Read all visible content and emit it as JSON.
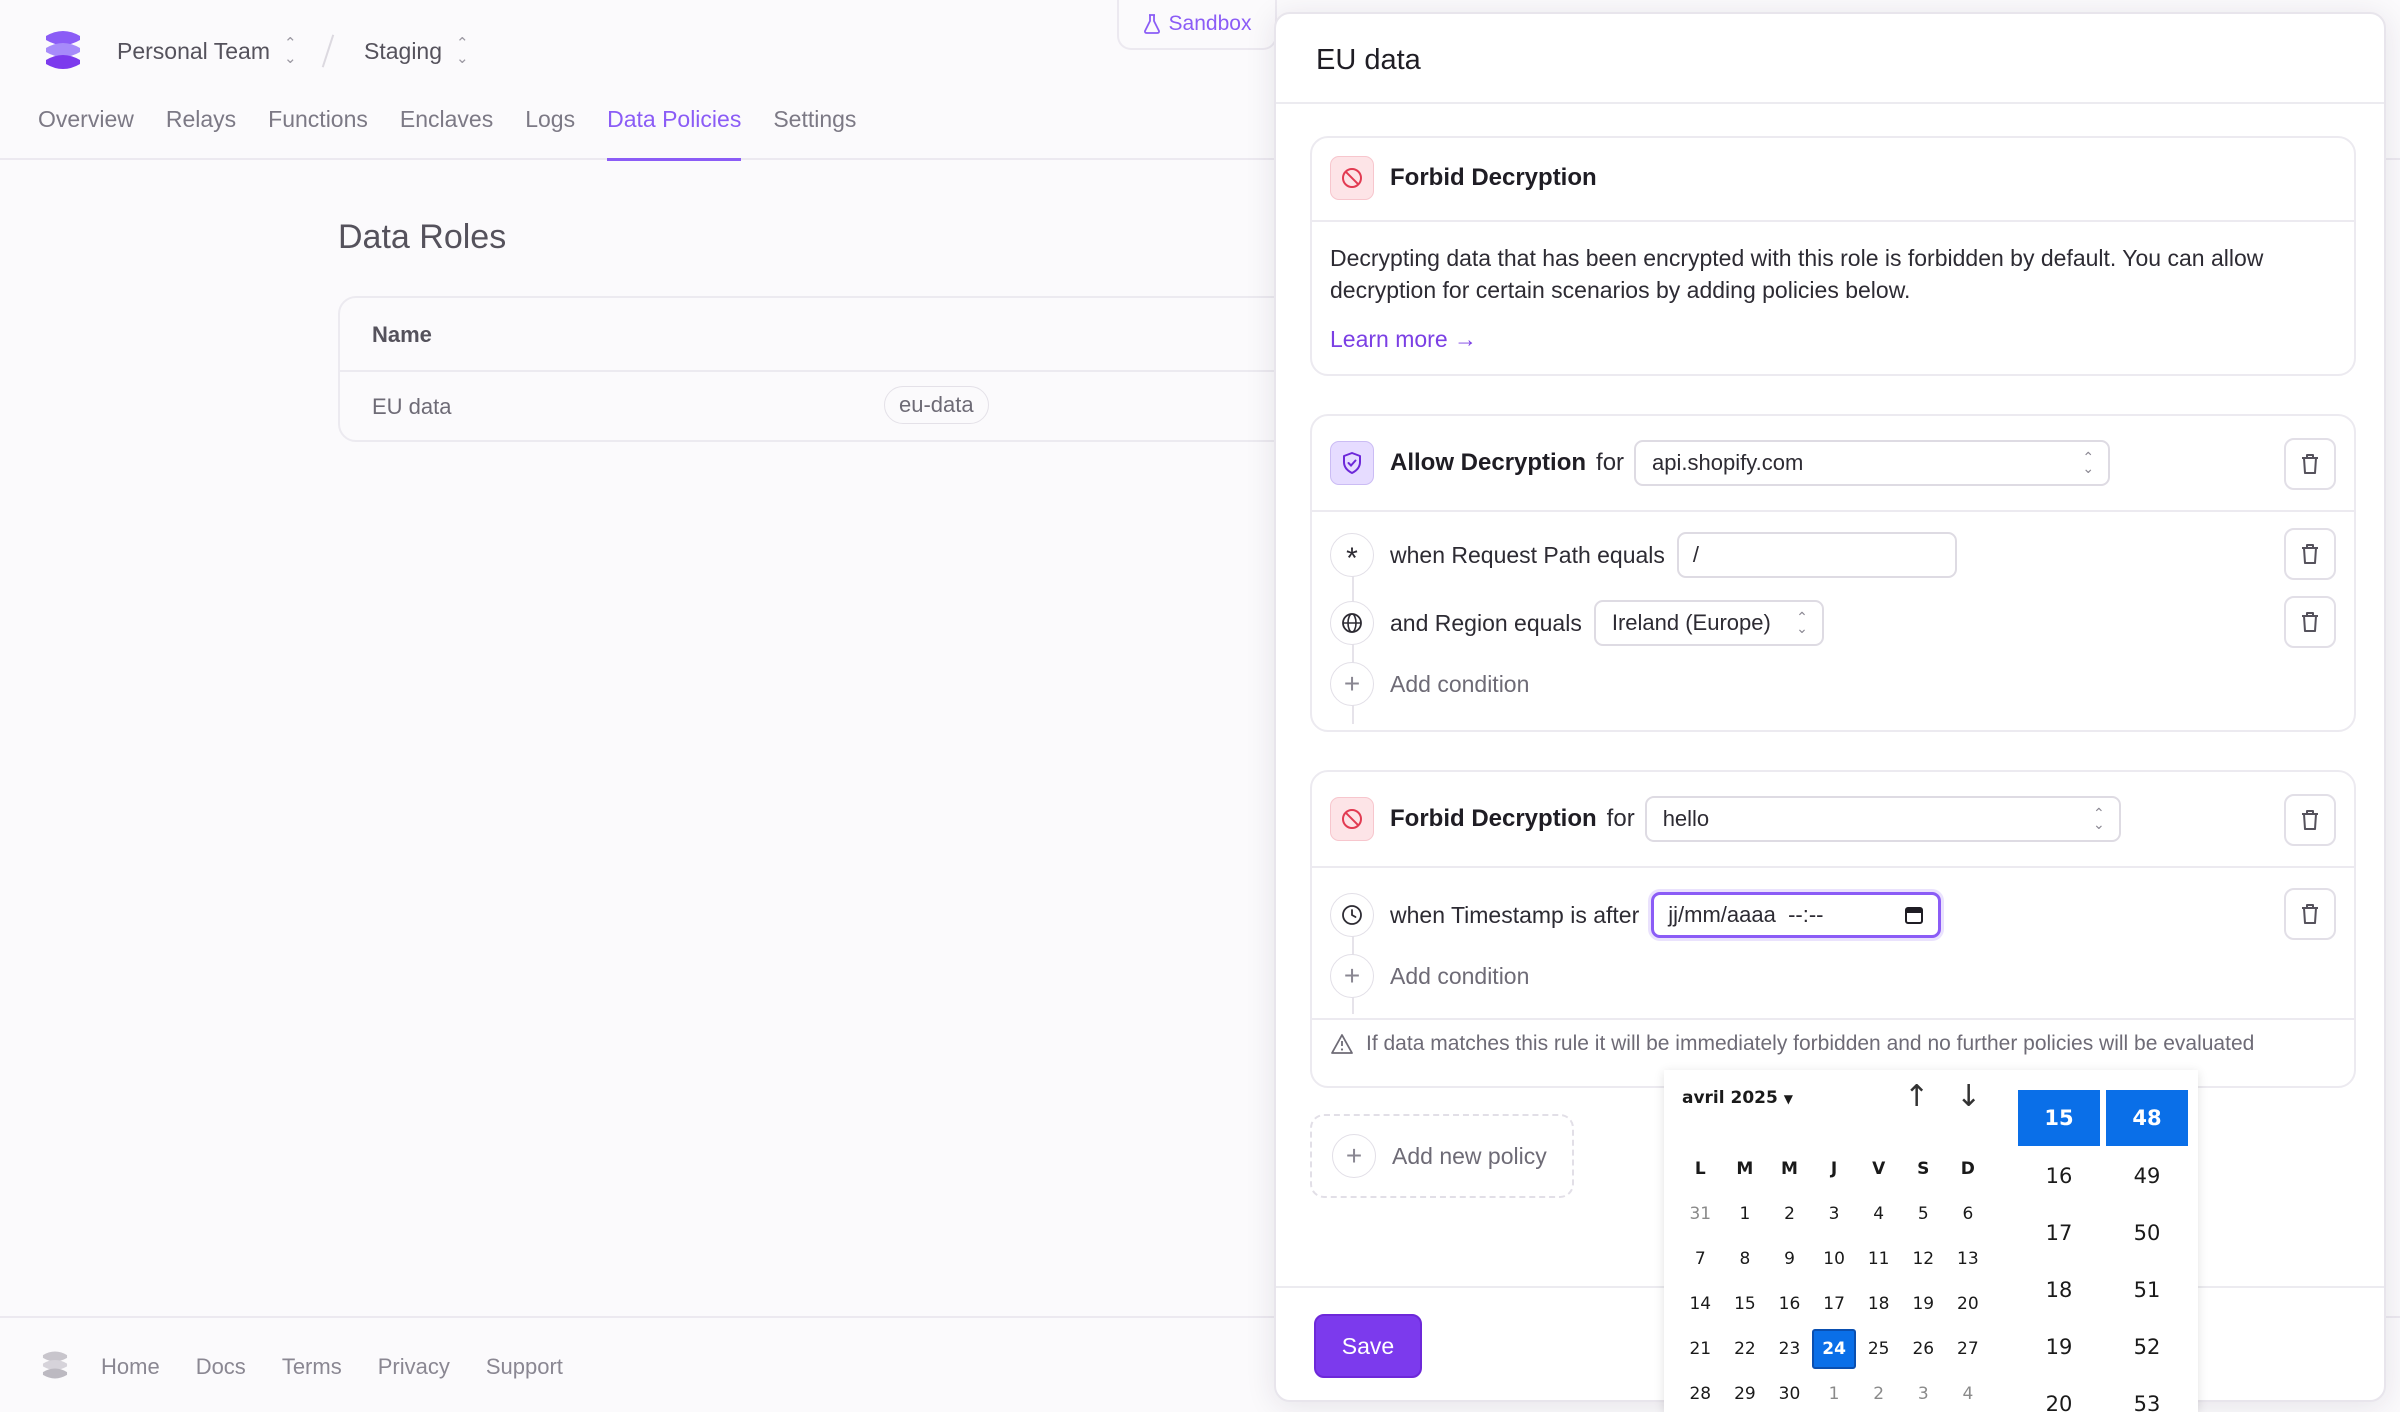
{
  "header": {
    "team": "Personal Team",
    "environment": "Staging",
    "sandbox_label": "Sandbox",
    "tabs": [
      {
        "label": "Overview"
      },
      {
        "label": "Relays"
      },
      {
        "label": "Functions"
      },
      {
        "label": "Enclaves"
      },
      {
        "label": "Logs"
      },
      {
        "label": "Data Policies",
        "active": true
      },
      {
        "label": "Settings"
      }
    ]
  },
  "roles": {
    "title": "Data Roles",
    "column_name": "Name",
    "rows": [
      {
        "name": "EU data",
        "key": "eu-data"
      }
    ]
  },
  "footer": {
    "links": [
      "Home",
      "Docs",
      "Terms",
      "Privacy",
      "Support"
    ]
  },
  "drawer": {
    "title": "EU data",
    "default_policy": {
      "label": "Forbid Decryption",
      "description": "Decrypting data that has been encrypted with this role is forbidden by default. You can allow decryption for certain scenarios by adding policies below.",
      "learn_more": "Learn more →"
    },
    "policies": [
      {
        "type_label": "Allow Decryption",
        "for_label": "for",
        "target": "api.shopify.com",
        "conditions": [
          {
            "text": "when Request Path equals",
            "value": "/",
            "icon": "asterisk-icon"
          },
          {
            "text": "and Region equals",
            "value": "Ireland (Europe)",
            "icon": "globe-icon"
          }
        ],
        "add_condition": "Add condition"
      },
      {
        "type_label": "Forbid Decryption",
        "for_label": "for",
        "target": "hello",
        "conditions": [
          {
            "text": "when Timestamp is after",
            "value": "jj/mm/aaaa  --:--",
            "icon": "clock-icon"
          }
        ],
        "add_condition": "Add condition",
        "warning": "If data matches this rule it will be immediately forbidden and no further policies will be evaluated"
      }
    ],
    "add_policy": "Add new policy",
    "save_label": "Save"
  },
  "picker": {
    "month_label": "avril 2025",
    "weekdays": [
      "L",
      "M",
      "M",
      "J",
      "V",
      "S",
      "D"
    ],
    "weeks": [
      [
        {
          "d": "31",
          "dim": true
        },
        {
          "d": "1"
        },
        {
          "d": "2"
        },
        {
          "d": "3"
        },
        {
          "d": "4"
        },
        {
          "d": "5"
        },
        {
          "d": "6"
        }
      ],
      [
        {
          "d": "7"
        },
        {
          "d": "8"
        },
        {
          "d": "9"
        },
        {
          "d": "10"
        },
        {
          "d": "11"
        },
        {
          "d": "12"
        },
        {
          "d": "13"
        }
      ],
      [
        {
          "d": "14"
        },
        {
          "d": "15"
        },
        {
          "d": "16"
        },
        {
          "d": "17"
        },
        {
          "d": "18"
        },
        {
          "d": "19"
        },
        {
          "d": "20"
        }
      ],
      [
        {
          "d": "21"
        },
        {
          "d": "22"
        },
        {
          "d": "23"
        },
        {
          "d": "24",
          "sel": true
        },
        {
          "d": "25"
        },
        {
          "d": "26"
        },
        {
          "d": "27"
        }
      ],
      [
        {
          "d": "28"
        },
        {
          "d": "29"
        },
        {
          "d": "30"
        },
        {
          "d": "1",
          "dim": true
        },
        {
          "d": "2",
          "dim": true
        },
        {
          "d": "3",
          "dim": true
        },
        {
          "d": "4",
          "dim": true
        }
      ]
    ],
    "hours": [
      "15",
      "16",
      "17",
      "18",
      "19",
      "20"
    ],
    "selected_hour": "15",
    "minutes": [
      "48",
      "49",
      "50",
      "51",
      "52",
      "53"
    ],
    "selected_minute": "48"
  },
  "colors": {
    "accent": "#8b5cf6",
    "save": "#7c3aed",
    "picker_selected": "#0a6fe8",
    "danger_bg": "#fde4e7"
  }
}
